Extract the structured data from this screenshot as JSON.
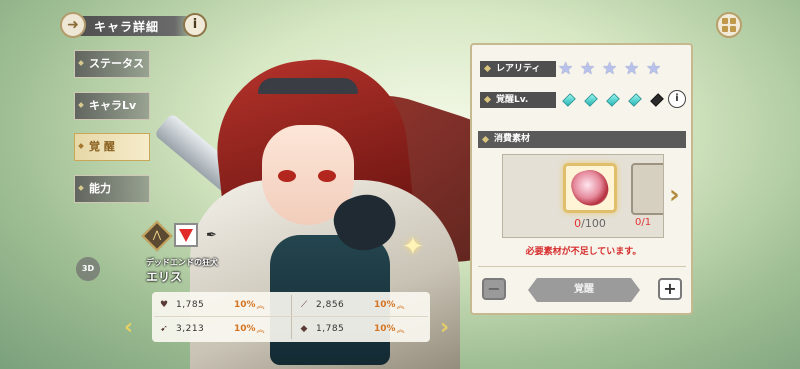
{
  "header": {
    "title": "キャラ詳細",
    "back_icon": "arrow-left-icon",
    "info_label": "i"
  },
  "menu": [
    {
      "label": "ステータス",
      "active": false
    },
    {
      "label": "キャラLv",
      "active": false
    },
    {
      "label": "覚 醒",
      "active": true
    },
    {
      "label": "能力",
      "active": false
    }
  ],
  "character": {
    "subtitle": "デッドエンドの狂犬",
    "name": "エリス",
    "btn_3d": "3D"
  },
  "stats": [
    {
      "icon": "♥",
      "value": "1,785",
      "pct": "10%",
      "name": "hp"
    },
    {
      "icon": "⟋",
      "value": "2,856",
      "pct": "10%",
      "name": "attack"
    },
    {
      "icon": "➹",
      "value": "3,213",
      "pct": "10%",
      "name": "speed"
    },
    {
      "icon": "◆",
      "value": "1,785",
      "pct": "10%",
      "name": "defense"
    }
  ],
  "panel": {
    "rarity_label": "レアリティ",
    "rarity_stars": 5,
    "awaken_label": "覚醒Lv.",
    "awaken_level": 4,
    "awaken_max": 5,
    "materials_label": "消費素材",
    "material_current": "0",
    "material_required": "/100",
    "peek_count": "0/1",
    "warning": "必要素材が不足しています。",
    "awaken_button": "覚醒",
    "minus": "−",
    "plus": "+"
  },
  "colors": {
    "accent": "#c9a757",
    "warning": "#d62c2c",
    "stat_pct": "#d57524"
  }
}
